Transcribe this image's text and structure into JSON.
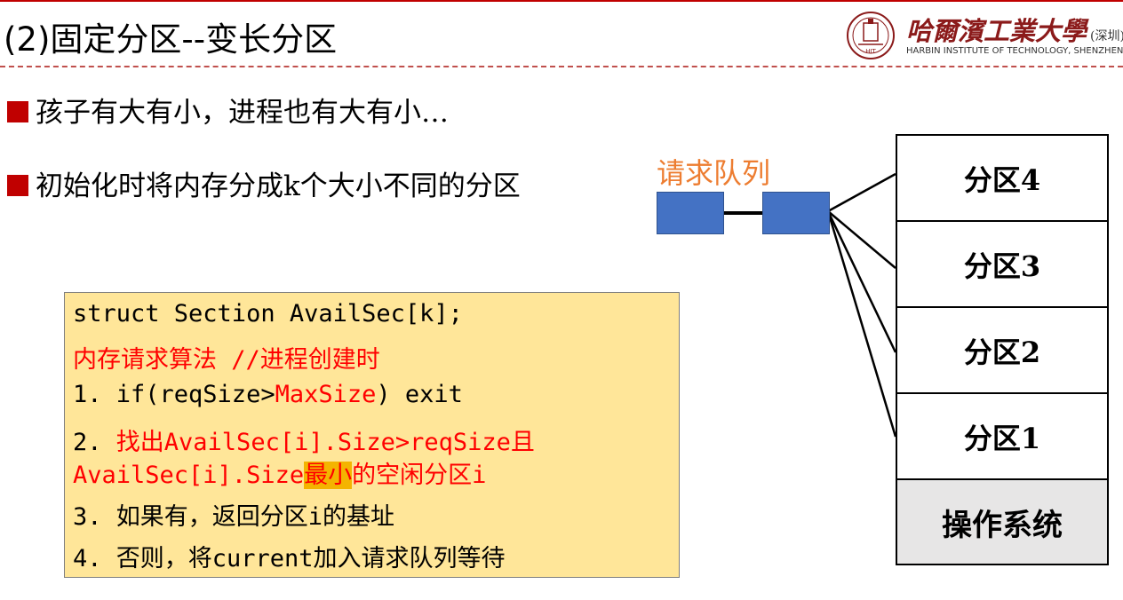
{
  "slide": {
    "title": "(2)固定分区--变长分区",
    "bullets": [
      "孩子有大有小，进程也有大有小…",
      "初始化时将内存分成k个大小不同的分区"
    ]
  },
  "logo": {
    "name": "哈爾濱工業大學",
    "city": "(深圳)",
    "english": "HARBIN INSTITUTE OF TECHNOLOGY, SHENZHEN",
    "seal_text": "HIT 1920"
  },
  "queue": {
    "label": "请求队列",
    "node_color": "#4472c4"
  },
  "memory": {
    "partitions": [
      "分区4",
      "分区3",
      "分区2",
      "分区1"
    ],
    "os_label": "操作系统"
  },
  "code": {
    "line1": "struct Section AvailSec[k];",
    "line2": "内存请求算法  //进程创建时",
    "line3_a": "  1. if(reqSize>",
    "line3_b": "MaxSize",
    "line3_c": ") exit",
    "line4_a": "  2. ",
    "line4_b": "找出AvailSec[i].Size>reqSize且",
    "line5_a": "AvailSec[i].Size",
    "line5_b": "最小",
    "line5_c": "的空闲分区i",
    "line6": "  3. 如果有，返回分区i的基址",
    "line7": "  4. 否则，将current加入请求队列等待"
  },
  "colors": {
    "accent_red": "#c00000",
    "code_bg": "#ffe699",
    "highlight": "#f4b400",
    "queue_label": "#ed7d31"
  }
}
